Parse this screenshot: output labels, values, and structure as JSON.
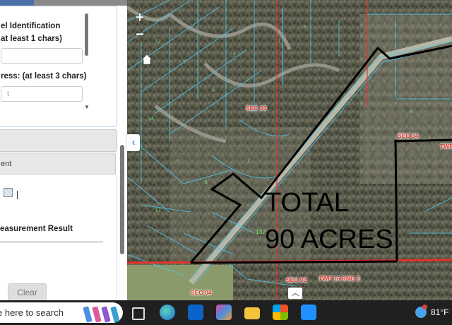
{
  "panel": {
    "parcel_label_line1": "el Identification",
    "parcel_label_line2": "at least 1 chars)",
    "address_label": "ress: (at least 3 chars)",
    "address_placeholder": "t",
    "measurement_header": "ent",
    "measurement_result_label": "easurement Result",
    "clear_label": "Clear"
  },
  "map": {
    "zoom_in": "+",
    "zoom_out": "−",
    "labels": {
      "sec33": "SEC 33",
      "sec34": "SEC 34",
      "sec03": "SEC 03",
      "sec04": "SEC 04",
      "twp_rng": "TWP 16  RNG 2",
      "twp_right": "TWP",
      "small_lot": "137"
    },
    "total_line1": "TOTAL",
    "total_line2": "90 ACRES"
  },
  "taskbar": {
    "search_text": "e here to search",
    "temperature": "81°F"
  },
  "colors": {
    "parcel_line": "#4fc3e6",
    "section_line": "#e8332b",
    "boundary": "#000000",
    "taskbar": "#202020"
  }
}
